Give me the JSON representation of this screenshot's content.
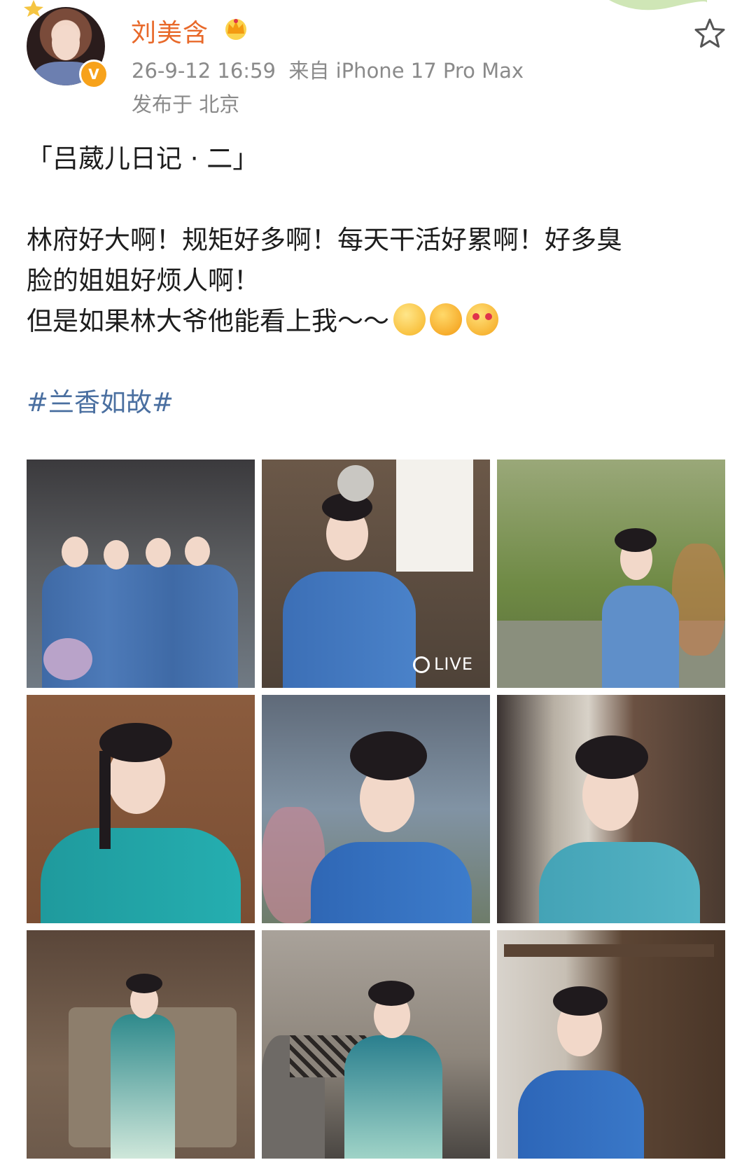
{
  "post": {
    "username": "刘美含",
    "timestamp": "26-9-12 16:59",
    "source": "来自 iPhone 17 Pro Max",
    "location": "发布于 北京",
    "badge_letter": "V",
    "content": {
      "title": "「吕葳儿日记 · 二」",
      "line1": "林府好大啊！规矩好多啊！每天干活好累啊！好多臭",
      "line2": "脸的姐姐好烦人啊！",
      "line3": "但是如果林大爷他能看上我～～",
      "emojis": [
        "scared-face-emoji",
        "drooling-face-emoji",
        "heart-eyes-emoji"
      ],
      "hashtag": "#兰香如故#"
    },
    "images": [
      {
        "name": "photo-1"
      },
      {
        "name": "photo-2",
        "badge": "LIVE"
      },
      {
        "name": "photo-3"
      },
      {
        "name": "photo-4"
      },
      {
        "name": "photo-5"
      },
      {
        "name": "photo-6"
      },
      {
        "name": "photo-7"
      },
      {
        "name": "photo-8"
      },
      {
        "name": "photo-9"
      }
    ]
  },
  "colors": {
    "username": "#e8692a",
    "meta": "#8a8a8a",
    "hashtag": "#4a6fa0",
    "verified": "#f7a21b"
  }
}
